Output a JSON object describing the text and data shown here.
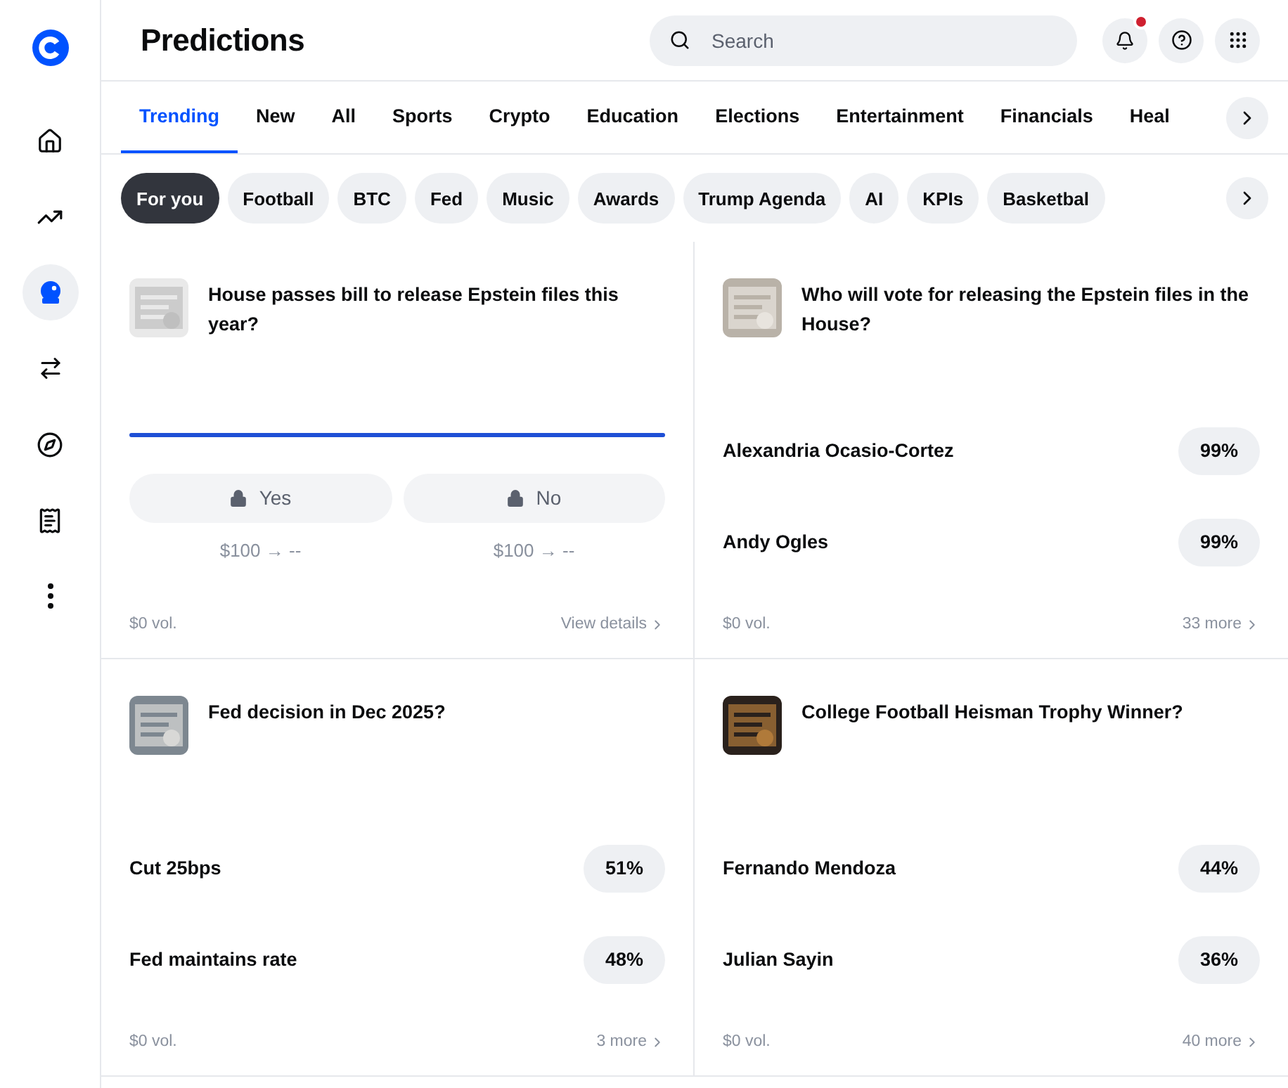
{
  "header": {
    "title": "Predictions",
    "search": {
      "placeholder": "Search"
    },
    "notifications": {
      "unread": true
    }
  },
  "sidebar": {
    "items": [
      {
        "selected": false
      },
      {
        "selected": false
      },
      {
        "selected": true
      },
      {
        "selected": false
      },
      {
        "selected": false
      },
      {
        "selected": false
      },
      {
        "selected": false
      }
    ]
  },
  "tabs": [
    {
      "label": "Trending",
      "selected": true
    },
    {
      "label": "New",
      "selected": false
    },
    {
      "label": "All",
      "selected": false
    },
    {
      "label": "Sports",
      "selected": false
    },
    {
      "label": "Crypto",
      "selected": false
    },
    {
      "label": "Education",
      "selected": false
    },
    {
      "label": "Elections",
      "selected": false
    },
    {
      "label": "Entertainment",
      "selected": false
    },
    {
      "label": "Financials",
      "selected": false
    },
    {
      "label": "Heal",
      "selected": false
    }
  ],
  "chips": [
    {
      "label": "For you",
      "selected": true
    },
    {
      "label": "Football",
      "selected": false
    },
    {
      "label": "BTC",
      "selected": false
    },
    {
      "label": "Fed",
      "selected": false
    },
    {
      "label": "Music",
      "selected": false
    },
    {
      "label": "Awards",
      "selected": false
    },
    {
      "label": "Trump Agenda",
      "selected": false
    },
    {
      "label": "AI",
      "selected": false
    },
    {
      "label": "KPIs",
      "selected": false
    },
    {
      "label": "Basketbal",
      "selected": false
    }
  ],
  "markets": [
    {
      "kind": "binary",
      "title": "House passes bill to release Epstein files this year?",
      "level": 1,
      "outcomes": [
        {
          "label": "Yes",
          "payout": "$100 → --"
        },
        {
          "label": "No",
          "payout": "$100 → --"
        }
      ],
      "volume": "$0 vol.",
      "link": "View details"
    },
    {
      "kind": "multi",
      "title": "Who will vote for releasing the Epstein files in the House?",
      "options": [
        {
          "name": "Alexandria Ocasio-Cortez",
          "chance": "99%"
        },
        {
          "name": "Andy Ogles",
          "chance": "99%"
        }
      ],
      "volume": "$0 vol.",
      "link": "33 more"
    },
    {
      "kind": "multi",
      "title": "Fed decision in Dec 2025?",
      "options": [
        {
          "name": "Cut 25bps",
          "chance": "51%"
        },
        {
          "name": "Fed maintains rate",
          "chance": "48%"
        }
      ],
      "volume": "$0 vol.",
      "link": "3 more"
    },
    {
      "kind": "multi",
      "title": "College Football Heisman Trophy Winner?",
      "options": [
        {
          "name": "Fernando Mendoza",
          "chance": "44%"
        },
        {
          "name": "Julian Sayin",
          "chance": "36%"
        }
      ],
      "volume": "$0 vol.",
      "link": "40 more"
    }
  ]
}
